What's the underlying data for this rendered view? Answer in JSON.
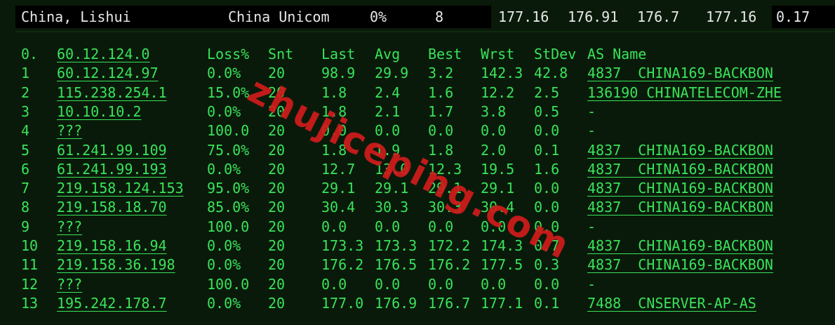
{
  "summary": {
    "location": "China, Lishui",
    "isp": "China Unicom",
    "loss": "0%",
    "sent": "8",
    "last": "177.16",
    "avg": "176.91",
    "best": "176.7",
    "worst": "177.16",
    "stdev": "0.17"
  },
  "mtr": {
    "header": {
      "hop": "0.",
      "host": "60.12.124.0",
      "loss": "Loss%",
      "snt": "Snt",
      "last": "Last",
      "avg": "Avg",
      "best": "Best",
      "wrst": "Wrst",
      "stdev": "StDev",
      "as": "AS Name"
    },
    "rows": [
      {
        "hop": "1",
        "host": "60.12.124.97",
        "loss": "0.0%",
        "snt": "20",
        "last": "98.9",
        "avg": "29.9",
        "best": "3.2",
        "wrst": "142.3",
        "stdev": "42.8",
        "as": "4837  CHINA169-BACKBON"
      },
      {
        "hop": "2",
        "host": "115.238.254.1",
        "loss": "15.0%",
        "snt": "20",
        "last": "1.8",
        "avg": "2.4",
        "best": "1.6",
        "wrst": "12.2",
        "stdev": "2.5",
        "as": "136190 CHINATELECOM-ZHE"
      },
      {
        "hop": "3",
        "host": "10.10.10.2",
        "loss": "0.0%",
        "snt": "20",
        "last": "1.8",
        "avg": "2.1",
        "best": "1.7",
        "wrst": "3.8",
        "stdev": "0.5",
        "as": "-"
      },
      {
        "hop": "4",
        "host": "???",
        "loss": "100.0",
        "snt": "20",
        "last": "0.0",
        "avg": "0.0",
        "best": "0.0",
        "wrst": "0.0",
        "stdev": "0.0",
        "as": "-"
      },
      {
        "hop": "5",
        "host": "61.241.99.109",
        "loss": "75.0%",
        "snt": "20",
        "last": "1.8",
        "avg": "1.9",
        "best": "1.8",
        "wrst": "2.0",
        "stdev": "0.1",
        "as": "4837  CHINA169-BACKBON"
      },
      {
        "hop": "6",
        "host": "61.241.99.193",
        "loss": "0.0%",
        "snt": "20",
        "last": "12.7",
        "avg": "13.0",
        "best": "12.3",
        "wrst": "19.5",
        "stdev": "1.6",
        "as": "4837  CHINA169-BACKBON"
      },
      {
        "hop": "7",
        "host": "219.158.124.153",
        "loss": "95.0%",
        "snt": "20",
        "last": "29.1",
        "avg": "29.1",
        "best": "29.1",
        "wrst": "29.1",
        "stdev": "0.0",
        "as": "4837  CHINA169-BACKBON"
      },
      {
        "hop": "8",
        "host": "219.158.18.70",
        "loss": "85.0%",
        "snt": "20",
        "last": "30.4",
        "avg": "30.3",
        "best": "30.3",
        "wrst": "30.4",
        "stdev": "0.0",
        "as": "4837  CHINA169-BACKBON"
      },
      {
        "hop": "9",
        "host": "???",
        "loss": "100.0",
        "snt": "20",
        "last": "0.0",
        "avg": "0.0",
        "best": "0.0",
        "wrst": "0.0",
        "stdev": "0.0",
        "as": "-"
      },
      {
        "hop": "10",
        "host": "219.158.16.94",
        "loss": "0.0%",
        "snt": "20",
        "last": "173.3",
        "avg": "173.3",
        "best": "172.2",
        "wrst": "174.3",
        "stdev": "0.7",
        "as": "4837  CHINA169-BACKBON"
      },
      {
        "hop": "11",
        "host": "219.158.36.198",
        "loss": "0.0%",
        "snt": "20",
        "last": "176.2",
        "avg": "176.5",
        "best": "176.2",
        "wrst": "177.5",
        "stdev": "0.3",
        "as": "4837  CHINA169-BACKBON"
      },
      {
        "hop": "12",
        "host": "???",
        "loss": "100.0",
        "snt": "20",
        "last": "0.0",
        "avg": "0.0",
        "best": "0.0",
        "wrst": "0.0",
        "stdev": "0.0",
        "as": "-"
      },
      {
        "hop": "13",
        "host": "195.242.178.7",
        "loss": "0.0%",
        "snt": "20",
        "last": "177.0",
        "avg": "176.9",
        "best": "176.7",
        "wrst": "177.1",
        "stdev": "0.1",
        "as": "7488  CNSERVER-AP-AS"
      }
    ]
  },
  "watermark": "zhujiceping.com",
  "colors": {
    "terminal_green": "#39e35a",
    "background": "#0a1a0a",
    "watermark_red": "#d11c1c"
  }
}
